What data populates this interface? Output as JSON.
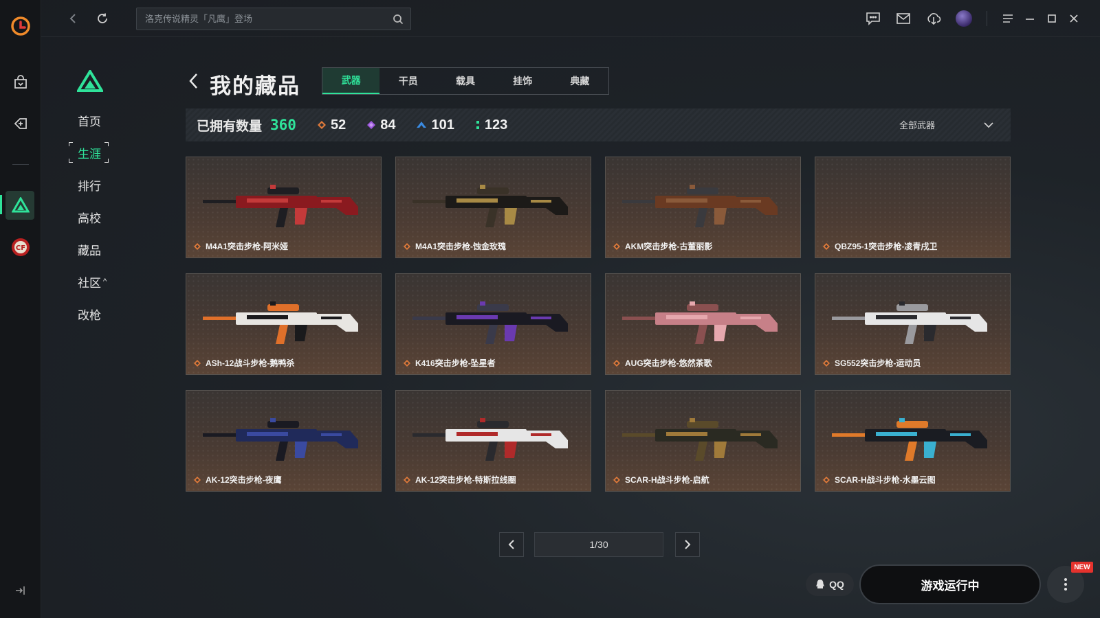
{
  "topbar": {
    "search_placeholder": "洛克传说精灵「凡鹰」登场"
  },
  "sidenav": {
    "items": [
      {
        "label": "首页"
      },
      {
        "label": "生涯"
      },
      {
        "label": "排行"
      },
      {
        "label": "高校"
      },
      {
        "label": "藏品"
      },
      {
        "label": "社区"
      },
      {
        "label": "改枪"
      }
    ],
    "community_arrow": "^"
  },
  "header": {
    "title": "我的藏品",
    "tabs": [
      {
        "label": "武器",
        "active": true
      },
      {
        "label": "干员"
      },
      {
        "label": "载具"
      },
      {
        "label": "挂饰"
      },
      {
        "label": "典藏"
      }
    ]
  },
  "stats": {
    "owned_label": "已拥有数量",
    "owned_total": "360",
    "counts": [
      {
        "value": "52",
        "color": "#e07a3a"
      },
      {
        "value": "84",
        "color": "#a05ae0"
      },
      {
        "value": "101",
        "color": "#3a8ae0"
      },
      {
        "value": "123",
        "color": "#2fe39a"
      }
    ],
    "filter_label": "全部武器"
  },
  "items": [
    {
      "name": "M4A1突击步枪-阿米娅",
      "palette": [
        "#8a1a1f",
        "#c33a3a",
        "#1e1e22"
      ]
    },
    {
      "name": "M4A1突击步枪-蚀金玫瑰",
      "palette": [
        "#1c1a18",
        "#a88a45",
        "#3a3228"
      ]
    },
    {
      "name": "AKM突击步枪-古董丽影",
      "palette": [
        "#6a3a22",
        "#8a5a3a",
        "#3a3a3e"
      ]
    },
    {
      "name": "QBZ95-1突击步枪-凌青戌卫",
      "palette": []
    },
    {
      "name": "ASh-12战斗步枪-鹅鸭杀",
      "palette": [
        "#e8e6e2",
        "#1a1a1c",
        "#e0702a"
      ]
    },
    {
      "name": "K416突击步枪-坠星者",
      "palette": [
        "#1a1a22",
        "#6a3ab0",
        "#3a3a4a"
      ]
    },
    {
      "name": "AUG突击步枪-悠然茶歌",
      "palette": [
        "#c78088",
        "#e6a8ae",
        "#8a5050"
      ]
    },
    {
      "name": "SG552突击步枪-运动员",
      "palette": [
        "#e6e6e6",
        "#2a2a2e",
        "#9a9a9e"
      ]
    },
    {
      "name": "AK-12突击步枪-夜鹰",
      "palette": [
        "#202a5a",
        "#3a4aa0",
        "#1a1a22"
      ]
    },
    {
      "name": "AK-12突击步枪-特斯拉线圈",
      "palette": [
        "#e6e6e6",
        "#b02a2a",
        "#2a2a2e"
      ]
    },
    {
      "name": "SCAR-H战斗步枪-启航",
      "palette": [
        "#2a2a22",
        "#a07a3a",
        "#5a4a2a"
      ]
    },
    {
      "name": "SCAR-H战斗步枪-水墨云图",
      "palette": [
        "#1a1c22",
        "#3ab0d0",
        "#e07a2a"
      ]
    }
  ],
  "pager": {
    "text": "1/30"
  },
  "bottom": {
    "qq_label": "QQ",
    "play_label": "游戏运行中",
    "new_badge": "NEW"
  }
}
